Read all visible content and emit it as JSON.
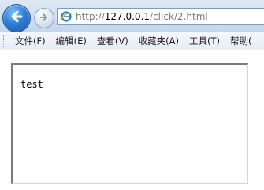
{
  "window": {
    "back_icon": "back-arrow-icon",
    "forward_icon": "forward-arrow-icon",
    "address": {
      "icon": "ie-icon",
      "scheme": "http://",
      "host": "127.0.0.1",
      "path": "/click/2.html"
    }
  },
  "menubar": {
    "items": [
      {
        "label": "文件(F)"
      },
      {
        "label": "编辑(E)"
      },
      {
        "label": "查看(V)"
      },
      {
        "label": "收藏夹(A)"
      },
      {
        "label": "工具(T)"
      },
      {
        "label": "帮助("
      }
    ]
  },
  "page": {
    "frame_text": "test"
  }
}
